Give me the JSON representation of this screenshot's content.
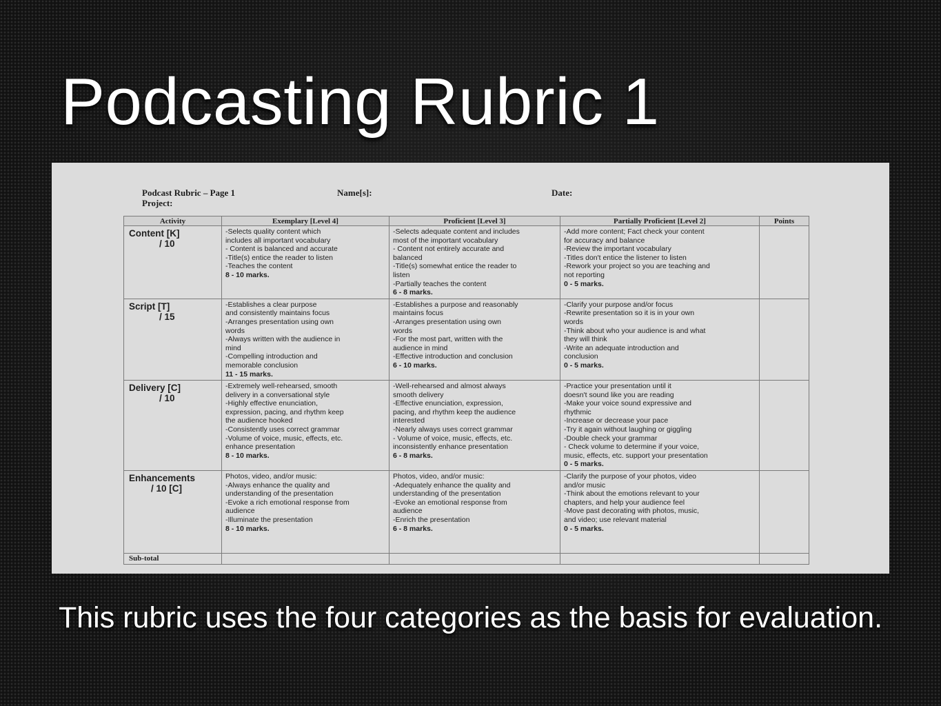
{
  "slide": {
    "title": "Podcasting Rubric 1",
    "caption": "This rubric uses the four categories as the basis for evaluation."
  },
  "document": {
    "header": {
      "title": "Podcast Rubric – Page 1",
      "names_label": "Name[s]:",
      "date_label": "Date:",
      "project_label": "Project:"
    },
    "columns": [
      "Activity",
      "Exemplary [Level 4]",
      "Proficient [Level 3]",
      "Partially Proficient [Level 2]",
      "Points"
    ],
    "rows": [
      {
        "activity": "Content [K]",
        "points_possible": "/ 10",
        "exemplary": " -Selects quality content which\nincludes all important vocabulary\n- Content is balanced and accurate\n-Title(s) entice the reader to listen\n-Teaches the content",
        "exemplary_marks": "8 - 10 marks.",
        "proficient": "-Selects adequate content and includes\nmost of the important vocabulary\n- Content not entirely accurate and\nbalanced\n -Title(s) somewhat entice the reader to\nlisten\n-Partially teaches the content",
        "proficient_marks": "6 - 8 marks.",
        "partial": "-Add more content; Fact check your content\nfor accuracy and balance\n-Review the important vocabulary\n-Titles don't entice the listener to listen\n-Rework your project so you are teaching and\nnot reporting",
        "partial_marks": " 0 - 5 marks."
      },
      {
        "activity": "Script [T]",
        "points_possible": "/ 15",
        "exemplary": "-Establishes a clear purpose\nand consistently maintains focus\n-Arranges presentation using own\nwords\n-Always written with the audience in\nmind\n-Compelling introduction and\nmemorable conclusion",
        "exemplary_marks": "11 - 15 marks.",
        "proficient": "-Establishes a purpose and reasonably\nmaintains focus\n-Arranges presentation using own\nwords\n-For the most part, written with the\naudience in mind\n-Effective introduction and conclusion",
        "proficient_marks": "6 - 10 marks.",
        "partial": "-Clarify your purpose and/or focus\n-Rewrite presentation so it is in your own\nwords\n-Think about who your audience is and what\nthey will think\n-Write an adequate introduction and\nconclusion",
        "partial_marks": "0 - 5 marks."
      },
      {
        "activity": "Delivery [C]",
        "points_possible": "/ 10",
        "exemplary": "-Extremely well-rehearsed, smooth\ndelivery in a conversational style\n-Highly effective enunciation,\nexpression, pacing, and rhythm keep\nthe audience hooked\n-Consistently uses correct grammar\n-Volume of voice, music, effects, etc.\nenhance presentation",
        "exemplary_marks": "8 - 10 marks.",
        "proficient": "-Well-rehearsed and almost always\nsmooth delivery\n-Effective enunciation, expression,\npacing, and rhythm keep the audience\ninterested\n-Nearly always uses correct grammar\n- Volume of voice, music, effects, etc.\ninconsistently enhance presentation",
        "proficient_marks": "6 - 8 marks.",
        "partial": "-Practice your presentation until it\ndoesn't sound like you are reading\n-Make your voice sound expressive and\nrhythmic\n-Increase or decrease your pace\n-Try it again without laughing or giggling\n-Double check your grammar\n- Check volume to determine if your voice,\nmusic, effects, etc. support your presentation",
        "partial_marks": "0 - 5 marks."
      },
      {
        "activity": "Enhancements",
        "points_possible": "/ 10 [C]",
        "exemplary": "Photos, video, and/or music:\n-Always enhance the quality and\nunderstanding of the presentation\n-Evoke a rich emotional response from\naudience\n-Illuminate the presentation",
        "exemplary_marks": "8 - 10 marks.",
        "proficient": "Photos, video, and/or music:\n-Adequately enhance the quality and\nunderstanding of the presentation\n-Evoke an emotional response from\naudience\n-Enrich the presentation",
        "proficient_marks": "6 - 8 marks.",
        "partial": "-Clarify the purpose of your photos, video\nand/or music\n-Think about the emotions relevant to your\nchapters, and help your audience feel\n-Move past decorating with photos, music,\nand video; use relevant material",
        "partial_marks": "0 - 5 marks."
      }
    ],
    "subtotal_label": "Sub-total"
  }
}
